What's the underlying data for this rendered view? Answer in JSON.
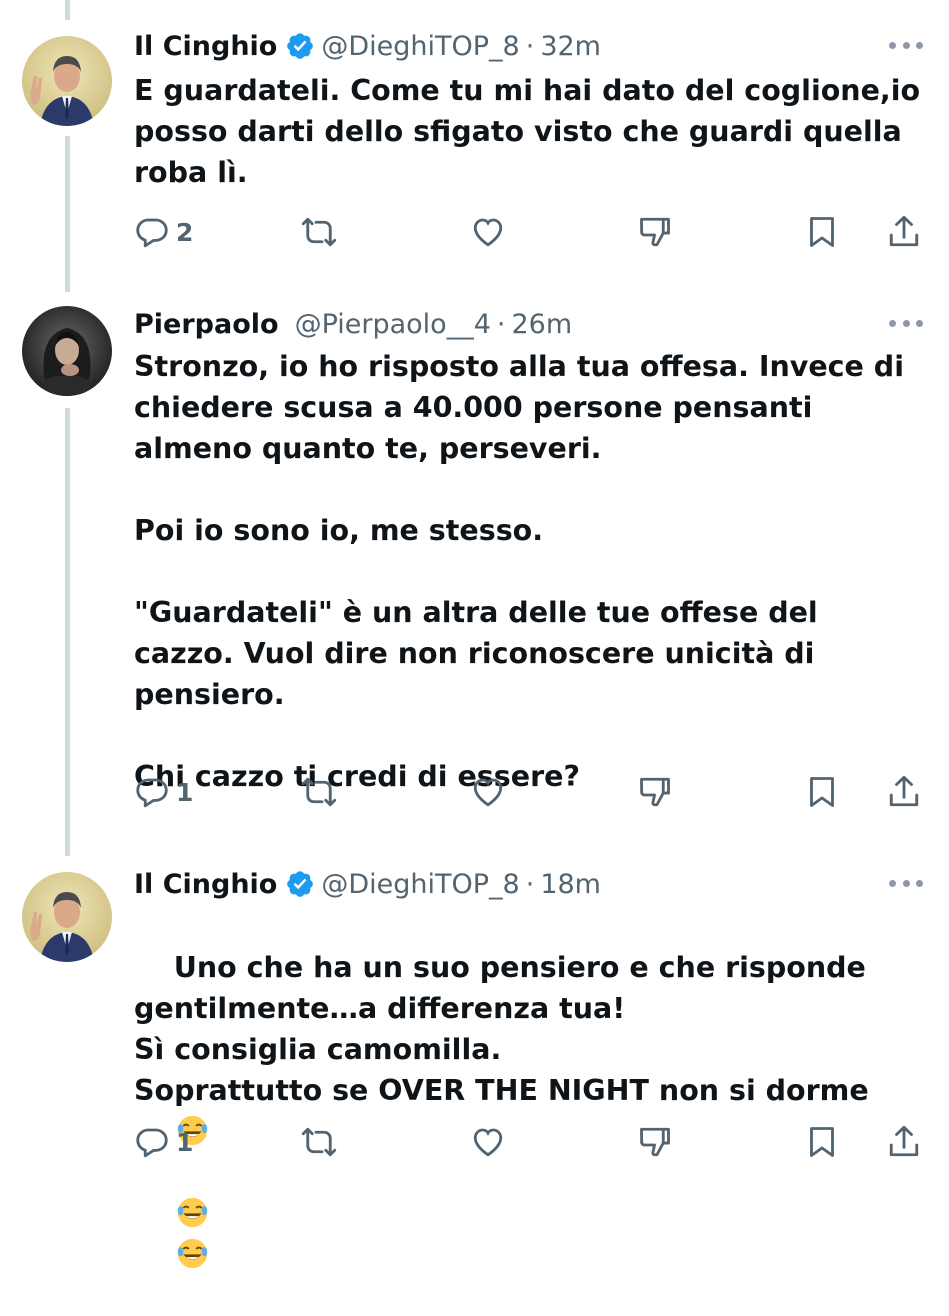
{
  "tweets": [
    {
      "name": "Il Cinghio",
      "verified": true,
      "handle": "@DieghiTOP_8",
      "separator": "·",
      "time": "32m",
      "text": "E guardateli. Come tu mi hai dato del coglione,io posso darti dello sfigato visto che guardi quella roba lì.",
      "replies": "2",
      "avatar": "man-suit-avatar"
    },
    {
      "name": "Pierpaolo",
      "verified": false,
      "handle": "@Pierpaolo__4",
      "separator": "·",
      "time": "26m",
      "text": "Stronzo, io ho risposto alla tua offesa. Invece di chiedere scusa a 40.000 persone pensanti almeno quanto te, perseveri.\n\nPoi io sono io, me stesso.\n\n\"Guardateli\" è un altra delle tue offese del cazzo. Vuol dire non riconoscere unicità di pensiero.\n\nChi cazzo ti credi di essere?",
      "replies": "1",
      "avatar": "woman-dark-hair-avatar"
    },
    {
      "name": "Il Cinghio",
      "verified": true,
      "handle": "@DieghiTOP_8",
      "separator": "·",
      "time": "18m",
      "text": "Uno che ha un suo pensiero e che risponde gentilmente…a differenza tua!\nSì consiglia camomilla.\nSoprattutto se OVER THE NIGHT non si dorme",
      "emoji": "laughing-tears-emoji",
      "replies": "1",
      "avatar": "man-suit-avatar"
    }
  ],
  "colors": {
    "text": "#0f1419",
    "secondary": "#536471",
    "verified": "#1d9bf0",
    "thread_line": "#cfd9de"
  }
}
